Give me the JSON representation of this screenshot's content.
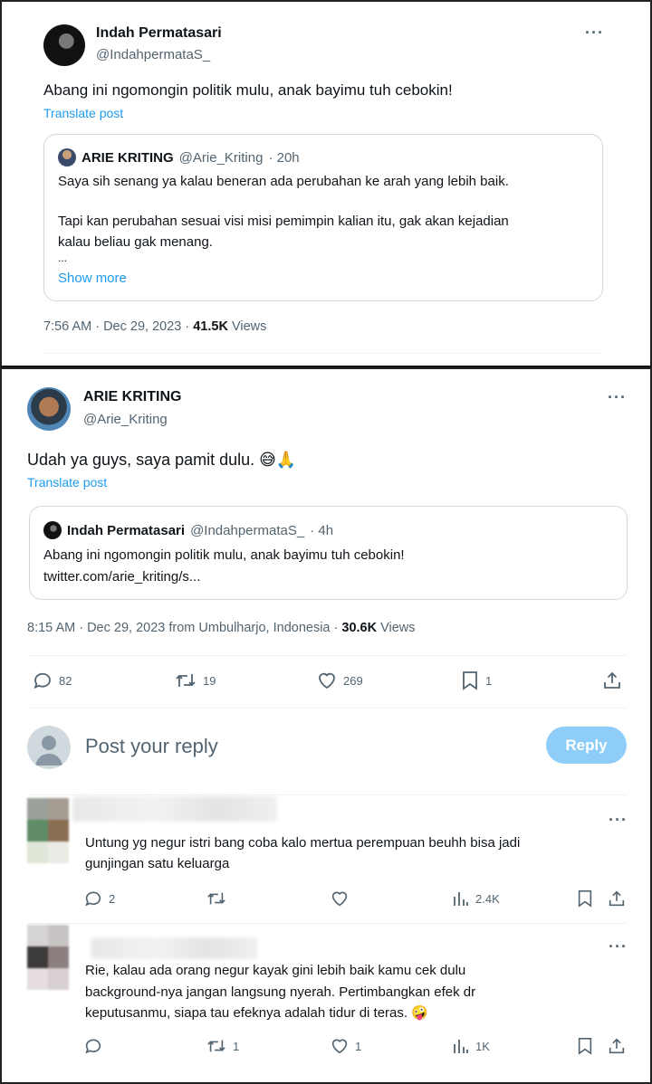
{
  "top_tweet": {
    "author_name": "Indah Permatasari",
    "author_handle": "@IndahpermataS_",
    "text": "Abang ini ngomongin politik mulu, anak bayimu tuh cebokin!",
    "translate_label": "Translate post",
    "quote": {
      "author_name": "ARIE KRITING",
      "author_handle": "@Arie_Kriting",
      "time": "· 20h",
      "line1": "Saya sih senang ya kalau beneran ada perubahan ke arah yang lebih baik.",
      "line2": "Tapi kan perubahan sesuai visi misi pemimpin kalian itu, gak akan kejadian",
      "line3": "kalau beliau gak menang.",
      "ellipsis": "...",
      "show_more": "Show more"
    },
    "meta_time": "7:56 AM · Dec 29, 2023 ·",
    "views_count": "41.5K",
    "views_label": "Views"
  },
  "main_tweet": {
    "author_name": "ARIE KRITING",
    "author_handle": "@Arie_Kriting",
    "text": "Udah ya guys, saya pamit dulu. 😅🙏",
    "translate_label": "Translate post",
    "quote": {
      "author_name": "Indah Permatasari",
      "author_handle": "@IndahpermataS_",
      "time": "· 4h",
      "line1": "Abang ini ngomongin politik mulu, anak bayimu tuh cebokin!",
      "line2": "twitter.com/arie_kriting/s..."
    },
    "meta_time": "8:15 AM · Dec 29, 2023 from Umbulharjo, Indonesia ·",
    "views_count": "30.6K",
    "views_label": "Views",
    "stats": {
      "replies": "82",
      "reposts": "19",
      "likes": "269",
      "bookmarks": "1"
    }
  },
  "reply_box": {
    "placeholder": "Post your reply",
    "button_label": "Reply"
  },
  "comments": [
    {
      "line1": "Untung yg negur istri bang coba kalo mertua perempuan beuhh bisa jadi",
      "line2": "gunjingan satu keluarga",
      "line3": "",
      "replies": "2",
      "reposts": "",
      "likes": "",
      "views": "2.4K"
    },
    {
      "line1": "Rie, kalau ada orang negur kayak gini lebih baik kamu cek dulu",
      "line2": "background-nya jangan langsung nyerah. Pertimbangkan efek dr",
      "line3": "keputusanmu, siapa tau efeknya adalah tidur di teras. 🤪",
      "replies": "",
      "reposts": "1",
      "likes": "1",
      "views": "1K"
    }
  ],
  "colors": {
    "accent": "#1d9bf0",
    "reply_button": "#8ecdf7",
    "muted": "#536471"
  },
  "icons": [
    "more-icon",
    "reply-icon",
    "repost-icon",
    "like-icon",
    "bookmark-icon",
    "share-icon",
    "views-icon"
  ]
}
